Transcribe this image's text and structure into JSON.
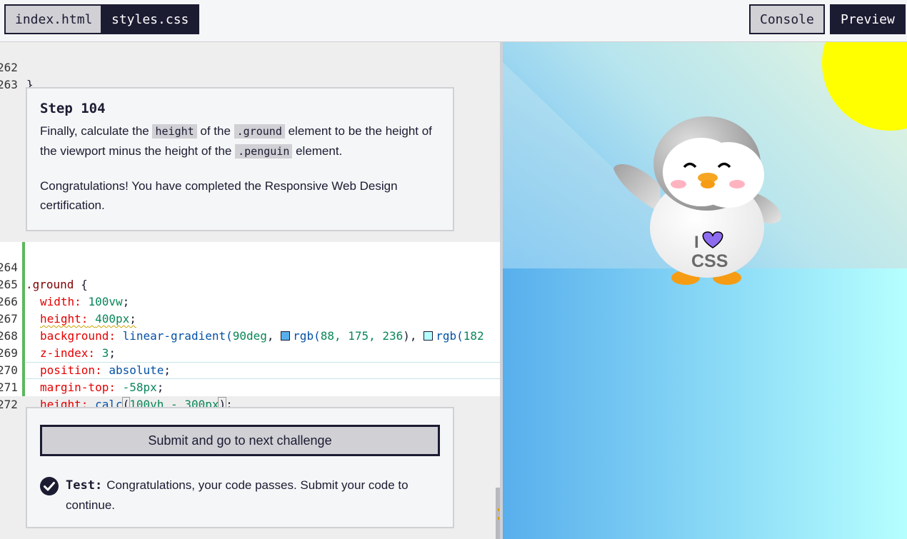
{
  "tabs": {
    "index": "index.html",
    "styles": "styles.css"
  },
  "top_actions": {
    "console": "Console",
    "preview": "Preview"
  },
  "editor": {
    "pre_lines": [
      {
        "num": "262",
        "text": "}"
      },
      {
        "num": "263",
        "text": ""
      }
    ],
    "lines": [
      {
        "num": "264"
      },
      {
        "num": "265"
      },
      {
        "num": "266"
      },
      {
        "num": "267"
      },
      {
        "num": "268"
      },
      {
        "num": "269"
      },
      {
        "num": "270"
      },
      {
        "num": "271"
      },
      {
        "num": "272"
      }
    ],
    "code": {
      "selector": ".ground",
      "open_brace": " {",
      "close_brace": "}",
      "width_prop": "width:",
      "width_val": "100vw",
      "height_prop": "height:",
      "height_val": "400px",
      "bg_prop": "background:",
      "bg_fn": "linear-gradient(",
      "bg_deg": "90deg",
      "bg_rgb1": "rgb(",
      "bg_rgb1_nums": "88, 175, 236",
      "bg_rgb2": "rgb(",
      "bg_rgb2_nums": "182",
      "z_prop": "z-index:",
      "z_val": "3",
      "pos_prop": "position:",
      "pos_val": "absolute",
      "mt_prop": "margin-top:",
      "mt_val": "-58px",
      "h2_prop": "height:",
      "h2_fn": "calc",
      "h2_args": "100vh - 300px"
    },
    "swatch_colors": {
      "first": "#58afec",
      "second": "#b6ffff"
    }
  },
  "instructions": {
    "title": "Step 104",
    "p1_a": "Finally, calculate the ",
    "p1_code1": "height",
    "p1_b": " of the ",
    "p1_code2": ".ground",
    "p1_c": " element to be the height of the viewport minus the height of the ",
    "p1_code3": ".penguin",
    "p1_d": " element.",
    "p2": "Congratulations! You have completed the Responsive Web Design certification."
  },
  "submit": {
    "button": "Submit and go to next challenge",
    "test_label": "Test:",
    "test_text": "Congratulations, your code passes. Submit your code to continue."
  },
  "preview": {
    "shirt_text_i": "I",
    "shirt_text_css": "CSS",
    "colors": {
      "sun": "#ffff00",
      "heart": "#8e6cf0",
      "beak": "#f6a623",
      "cheek": "#ffb3c1"
    }
  }
}
